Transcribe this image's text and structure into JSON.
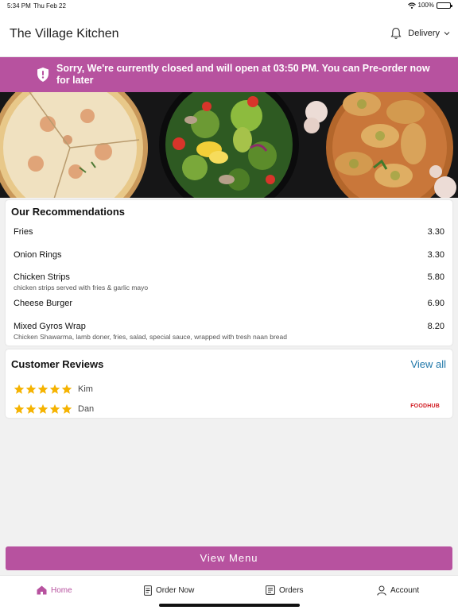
{
  "status_bar": {
    "time": "5:34 PM",
    "date": "Thu Feb 22",
    "battery": "100%"
  },
  "header": {
    "title": "The Village Kitchen",
    "mode": "Delivery"
  },
  "banner": {
    "message": "Sorry, We're currently closed and will open at 03:50 PM. You can Pre-order now for later"
  },
  "hero": {
    "dishes": [
      "pizza",
      "salad",
      "garlic-bread"
    ]
  },
  "recommendations": {
    "title": "Our Recommendations",
    "items": [
      {
        "name": "Fries",
        "desc": "",
        "price": "3.30"
      },
      {
        "name": "Onion Rings",
        "desc": "",
        "price": "3.30"
      },
      {
        "name": "Chicken Strips",
        "desc": "chicken strips served with fries & garlic mayo",
        "price": "5.80"
      },
      {
        "name": "Cheese Burger",
        "desc": "",
        "price": "6.90"
      },
      {
        "name": "Mixed Gyros Wrap",
        "desc": "Chicken Shawarma, lamb doner, fries, salad, special sauce, wrapped with tresh naan bread",
        "price": "8.20"
      }
    ]
  },
  "reviews": {
    "title": "Customer Reviews",
    "view_all": "View all",
    "items": [
      {
        "name": "Kim",
        "rating": 5
      },
      {
        "name": "Dan",
        "rating": 5
      }
    ],
    "source": "FOODHUB",
    "star_color": "#f5b301"
  },
  "view_menu": "View Menu",
  "tabs": [
    {
      "label": "Home",
      "icon": "home-icon",
      "active": true
    },
    {
      "label": "Order Now",
      "icon": "order-icon",
      "active": false
    },
    {
      "label": "Orders",
      "icon": "receipt-icon",
      "active": false
    },
    {
      "label": "Account",
      "icon": "user-icon",
      "active": false
    }
  ],
  "colors": {
    "accent": "#b7529f",
    "link": "#1e76a8"
  }
}
